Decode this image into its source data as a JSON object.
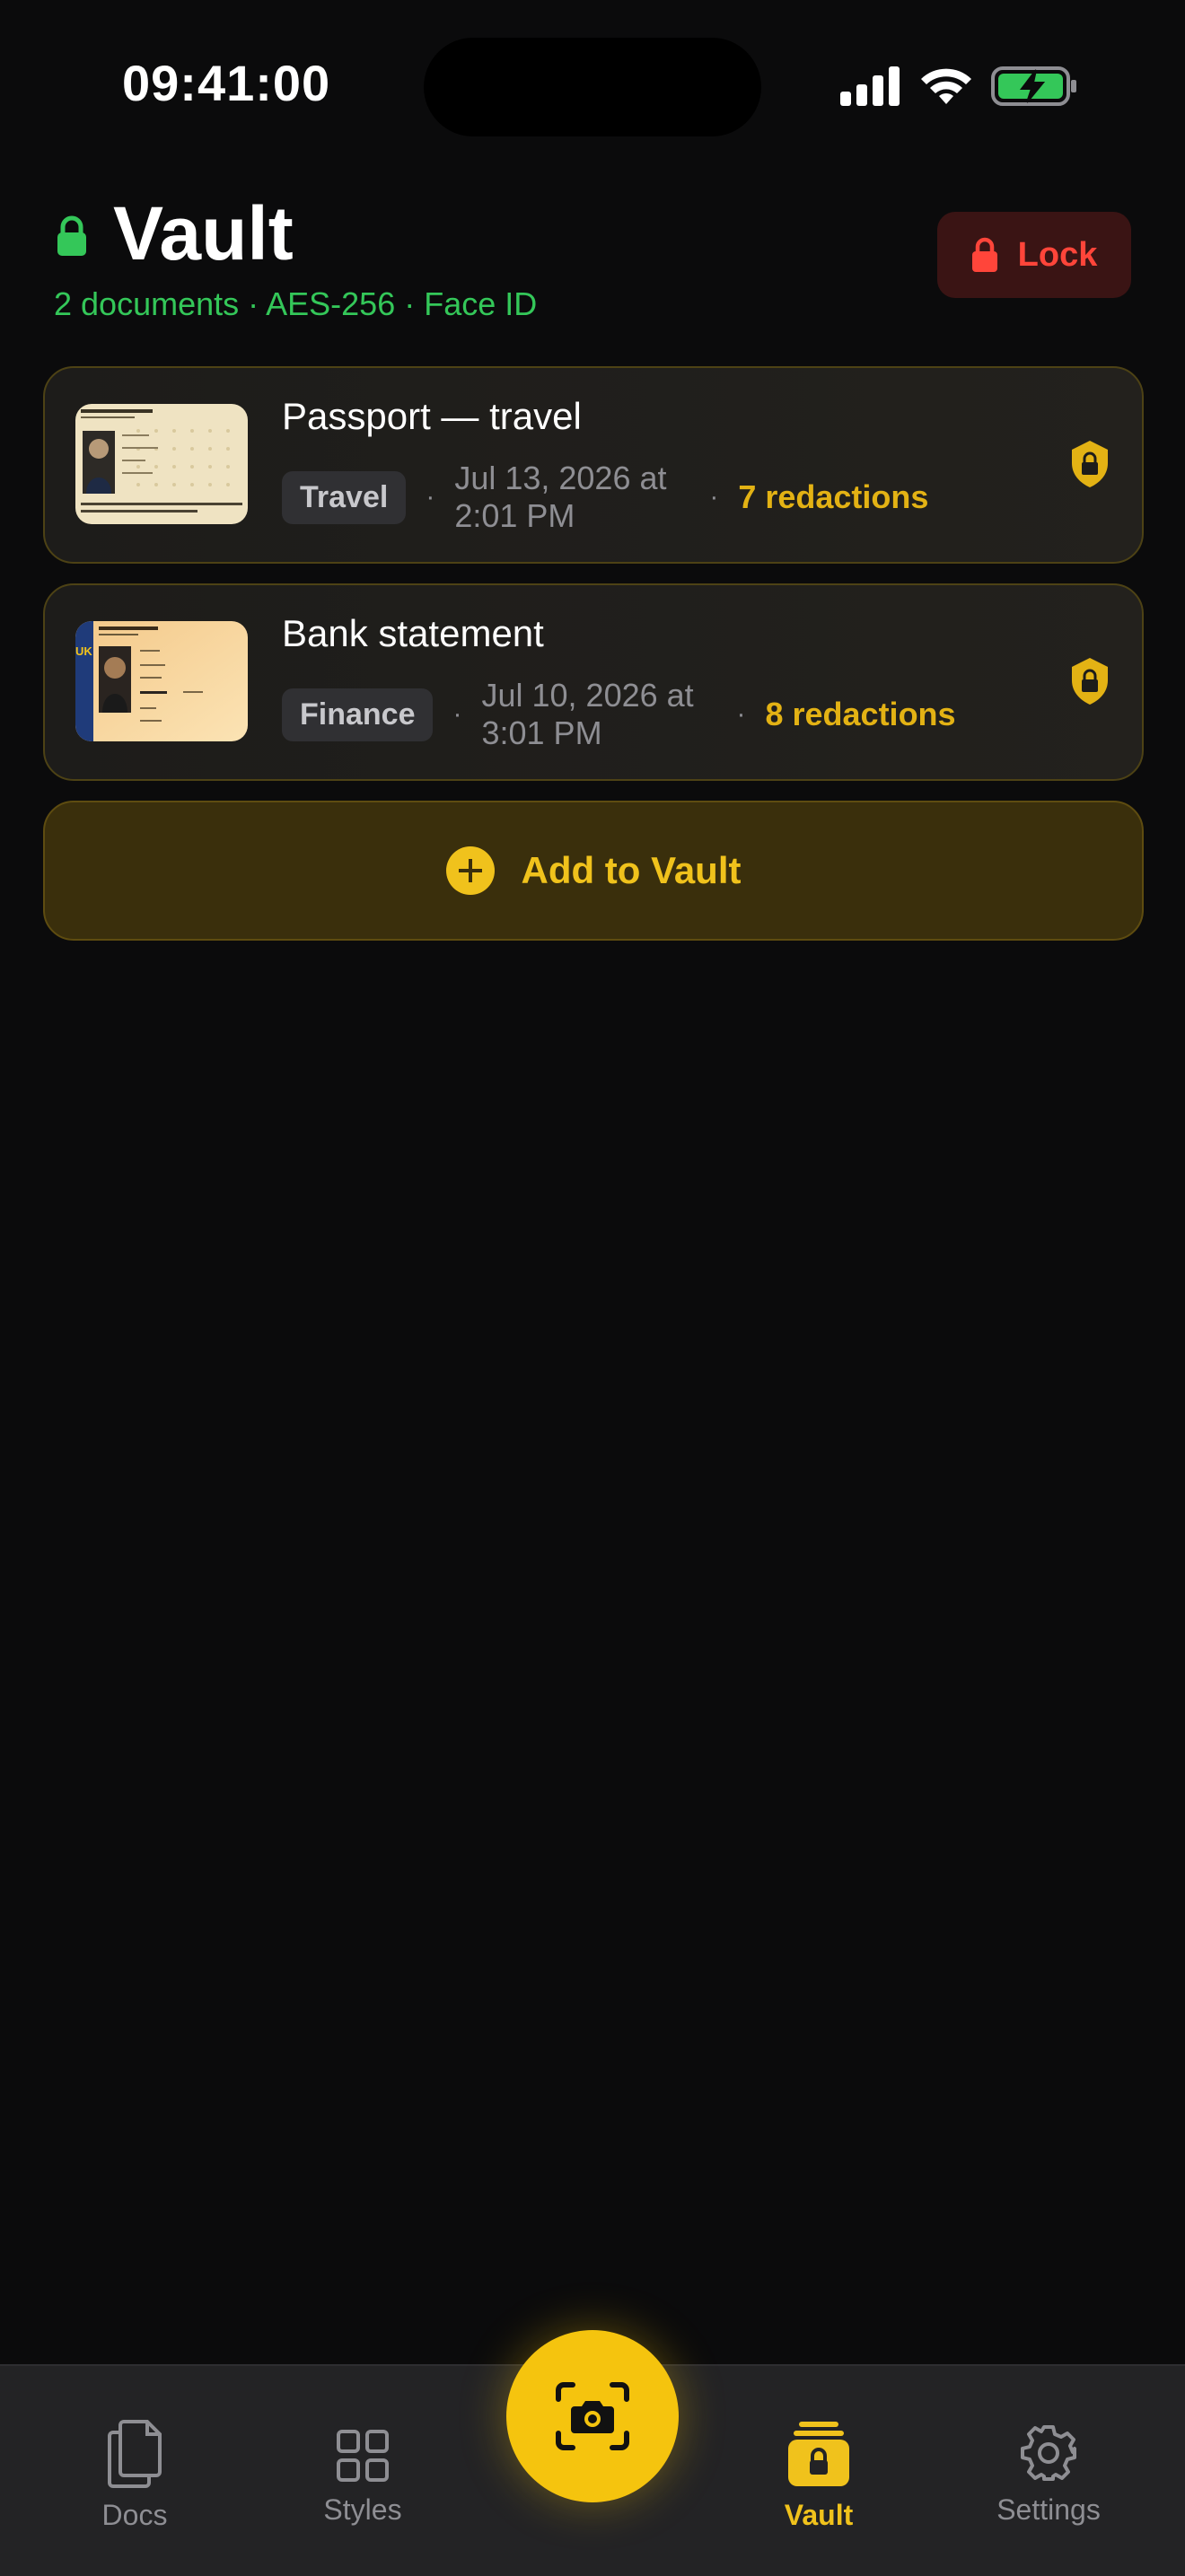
{
  "status_bar": {
    "time": "09:41:00"
  },
  "header": {
    "title": "Vault",
    "subtitle": "2 documents · AES-256 · Face ID",
    "lock_label": "Lock"
  },
  "documents": [
    {
      "title": "Passport — travel",
      "tag": "Travel",
      "date": "Jul 13, 2026 at 2:01 PM",
      "redactions": "7 redactions"
    },
    {
      "title": "Bank statement",
      "tag": "Finance",
      "date": "Jul 10, 2026 at 3:01 PM",
      "redactions": "8 redactions"
    }
  ],
  "add_button": {
    "label": "Add to Vault"
  },
  "tabbar": {
    "tabs": [
      {
        "label": "Docs",
        "icon": "docs-icon"
      },
      {
        "label": "Styles",
        "icon": "grid-icon"
      },
      {
        "label": "Vault",
        "icon": "vault-icon",
        "active": true
      },
      {
        "label": "Settings",
        "icon": "gear-icon"
      }
    ],
    "center_icon": "camera-scan-icon"
  },
  "colors": {
    "accent": "#f0c21c",
    "secure": "#34c759",
    "danger": "#ff453a",
    "background": "#0b0b0c"
  }
}
